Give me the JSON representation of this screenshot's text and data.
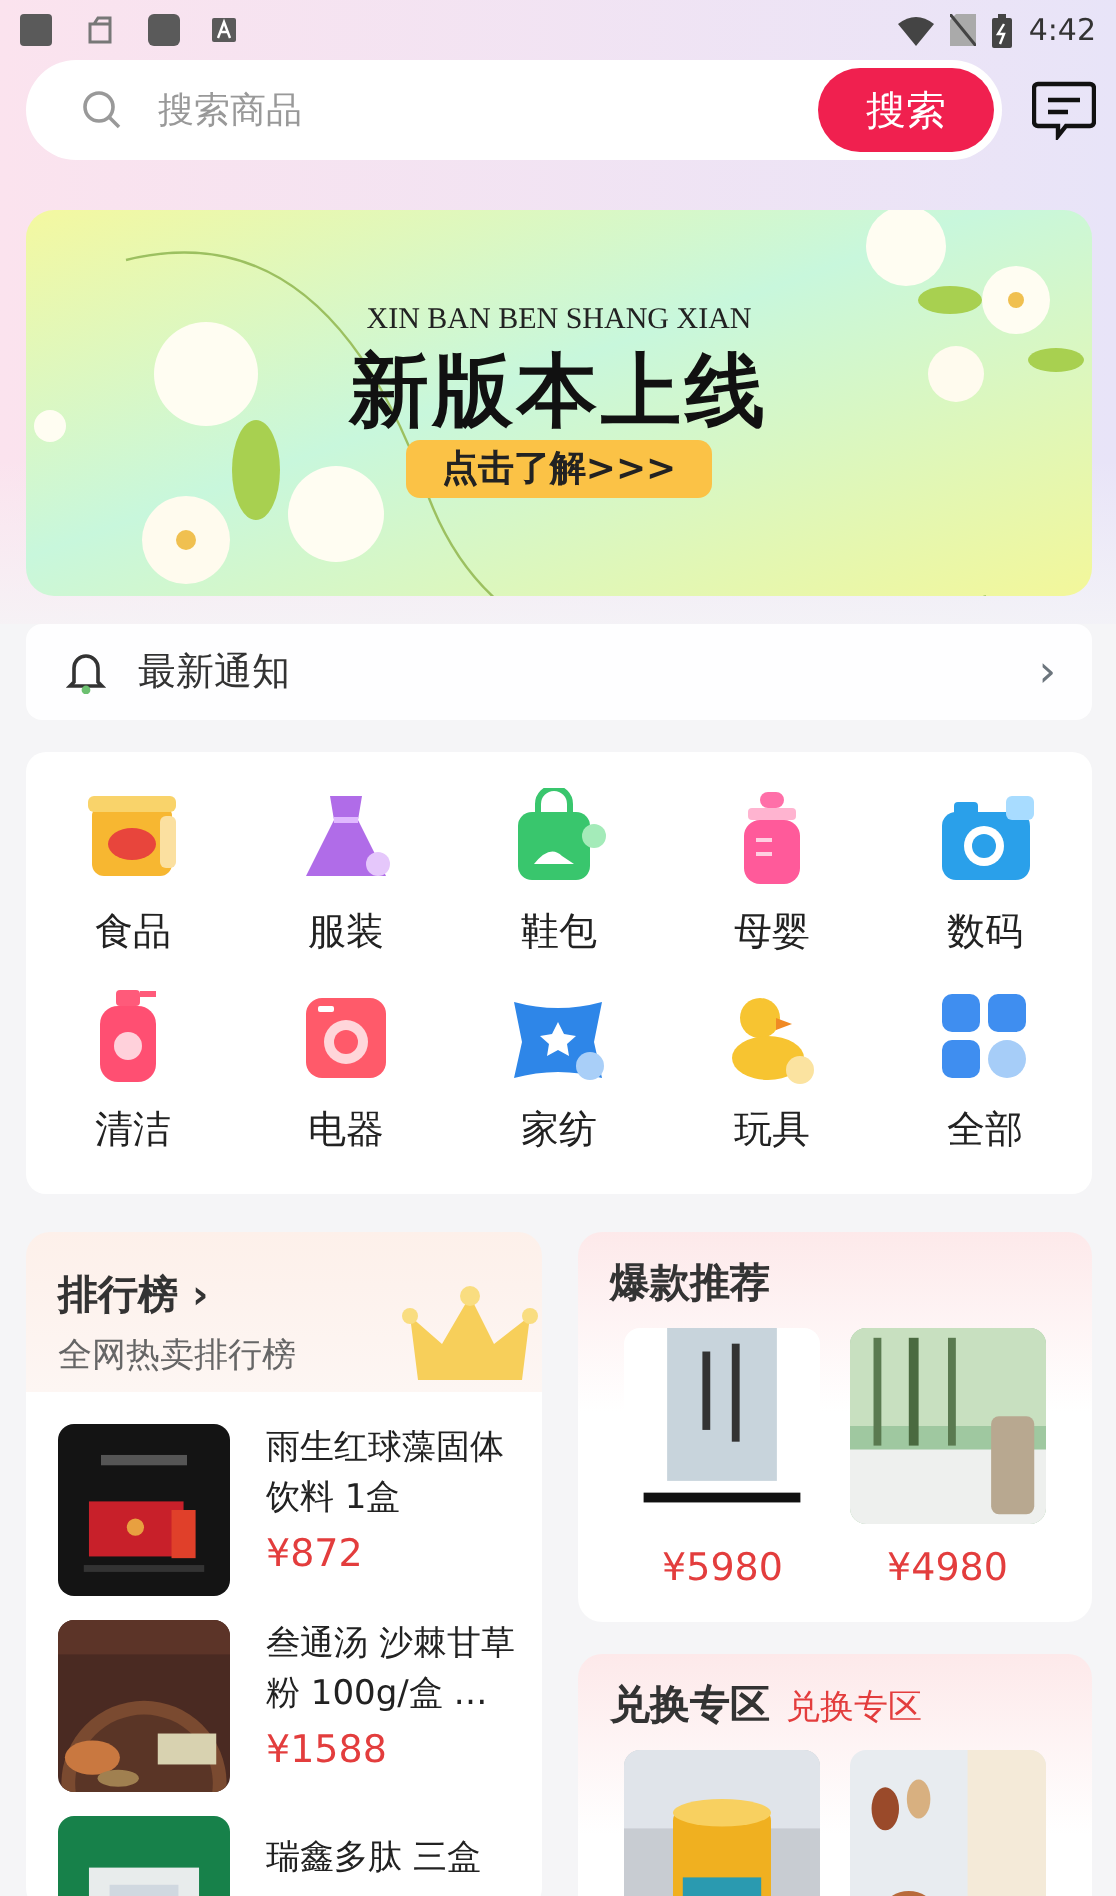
{
  "status_bar": {
    "time": "4:42"
  },
  "search": {
    "placeholder": "搜索商品",
    "button": "搜索"
  },
  "banner": {
    "subtitle": "XIN BAN BEN SHANG XIAN",
    "title": "新版本上线",
    "button": "点击了解>>>"
  },
  "notice": {
    "label": "最新通知",
    "arrow": "›"
  },
  "categories": [
    {
      "label": "食品"
    },
    {
      "label": "服装"
    },
    {
      "label": "鞋包"
    },
    {
      "label": "母婴"
    },
    {
      "label": "数码"
    },
    {
      "label": "清洁"
    },
    {
      "label": "电器"
    },
    {
      "label": "家纺"
    },
    {
      "label": "玩具"
    },
    {
      "label": "全部"
    }
  ],
  "ranking": {
    "title": "排行榜",
    "arrow": "›",
    "subtitle": "全网热卖排行榜",
    "items": [
      {
        "name": "雨生红球藻固体饮料 1盒",
        "price": "¥872"
      },
      {
        "name": "叁通汤 沙棘甘草粉 100g/盒 …",
        "price": "¥1588"
      },
      {
        "name": "瑞鑫多肽 三盒"
      }
    ]
  },
  "hot": {
    "title": "爆款推荐",
    "items": [
      {
        "price": "¥5980"
      },
      {
        "price": "¥4980"
      }
    ]
  },
  "exchange": {
    "title": "兑换专区",
    "tag": "兑换专区"
  }
}
